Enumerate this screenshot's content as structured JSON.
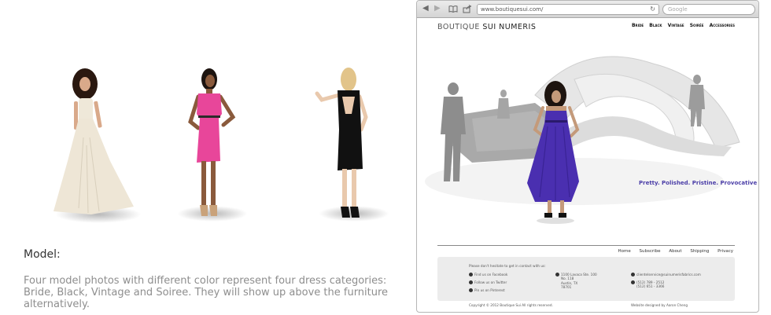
{
  "caption": {
    "title": "Model:",
    "description": "Four model photos with different color represent four dress categories: Bride, Black, Vintage and Soiree. They will show up above the furniture alternatively."
  },
  "models": [
    {
      "category": "Bride",
      "dress_color": "#eee6d6"
    },
    {
      "category": "Vintage",
      "dress_color": "#e8469a"
    },
    {
      "category": "Black",
      "dress_color": "#111111"
    }
  ],
  "browser": {
    "url": "www.boutiquesui.com/",
    "search_placeholder": "Google",
    "back_icon": "back-arrow-icon",
    "forward_icon": "forward-arrow-icon",
    "bookmarks_icon": "open-book-icon",
    "share_icon": "share-icon",
    "reload_icon": "reload-icon"
  },
  "site": {
    "logo_light": "BOUTIQUE",
    "logo_dark": "SUI NUMERIS",
    "nav": [
      "Bride",
      "Black",
      "Vintage",
      "Soirée",
      "Accessories"
    ],
    "tagline": "Pretty. Polished. Pristine. Provocative",
    "hero_dress_color": "#4a2fb0",
    "footer_nav": [
      "Home",
      "Subscribe",
      "About",
      "Shipping",
      "Privacy"
    ],
    "footer": {
      "intro": "Please don't hesitate to get in contact with us:",
      "facebook": "Find us on Facebook",
      "twitter": "Follow us on Twitter",
      "pinterest": "Pin us on Pinterest",
      "address": [
        "1100 Lavaca Ste. 100",
        "No. 118",
        "Austin, TX",
        "78701"
      ],
      "email": "clientelservice@suinumerisfabrics.com",
      "phone": [
        "(512) 789 - 2512",
        "(512) 651 - 3366"
      ],
      "copyright": "Copyright © 2012 Boutique Sui All rights reserved.",
      "designer": "Website designed by Aaron Cheng"
    }
  }
}
